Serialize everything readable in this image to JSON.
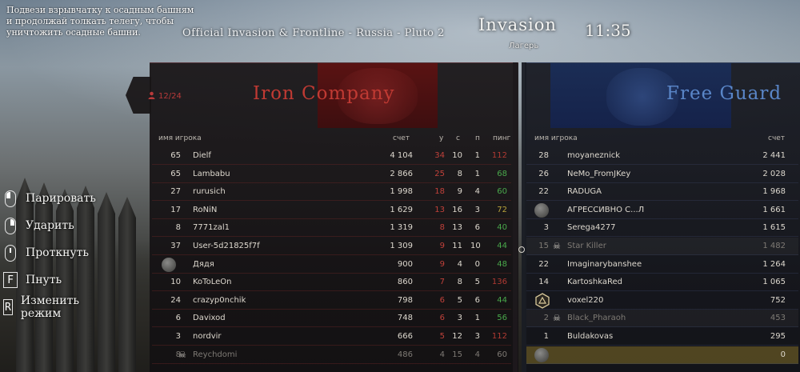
{
  "objective": "Подвези взрывчатку к осадным башням и продолжай толкать телегу, чтобы уничтожить осадные башни.",
  "server_name": "Official Invasion & Frontline - Russia - Pluto 2",
  "mode": {
    "title": "Invasion",
    "subtitle": "Лагерь",
    "clock": "11:35"
  },
  "controls": [
    {
      "icon": "mouse-left-icon",
      "label": "Парировать"
    },
    {
      "icon": "mouse-right-icon",
      "label": "Ударить"
    },
    {
      "icon": "mouse-middle-icon",
      "label": "Проткнуть"
    },
    {
      "key": "F",
      "label": "Пнуть"
    },
    {
      "key": "R",
      "label": "Изменить режим"
    }
  ],
  "left_team": {
    "name": "Iron Company",
    "player_count": "12/24",
    "color": "#c03a33",
    "headers": {
      "name": "имя игрока",
      "score": "счет",
      "kills": "у",
      "deaths": "с",
      "assists": "п",
      "ping": "пинг"
    },
    "players": [
      {
        "level": "65",
        "name": "Dielf",
        "score": "4 104",
        "kills": "34",
        "deaths": "10",
        "assists": "1",
        "ping": "112"
      },
      {
        "level": "65",
        "name": "Lambabu",
        "score": "2 866",
        "kills": "25",
        "deaths": "8",
        "assists": "1",
        "ping": "68"
      },
      {
        "level": "27",
        "name": "rurusich",
        "score": "1 998",
        "kills": "18",
        "deaths": "9",
        "assists": "4",
        "ping": "60"
      },
      {
        "level": "17",
        "name": "RoNiN",
        "score": "1 629",
        "kills": "13",
        "deaths": "16",
        "assists": "3",
        "ping": "72"
      },
      {
        "level": "8",
        "name": "7771zal1",
        "score": "1 319",
        "kills": "8",
        "deaths": "13",
        "assists": "6",
        "ping": "40"
      },
      {
        "level": "37",
        "name": "User-5d21825f7f",
        "score": "1 309",
        "kills": "9",
        "deaths": "11",
        "assists": "10",
        "ping": "44"
      },
      {
        "level": "",
        "name": "Дядя",
        "score": "900",
        "kills": "9",
        "deaths": "4",
        "assists": "0",
        "ping": "48"
      },
      {
        "level": "10",
        "name": "KoToLeOn",
        "score": "860",
        "kills": "7",
        "deaths": "8",
        "assists": "5",
        "ping": "136"
      },
      {
        "level": "24",
        "name": "crazyp0nchik",
        "score": "798",
        "kills": "6",
        "deaths": "5",
        "assists": "6",
        "ping": "44"
      },
      {
        "level": "6",
        "name": "Davixod",
        "score": "748",
        "kills": "6",
        "deaths": "3",
        "assists": "1",
        "ping": "56"
      },
      {
        "level": "3",
        "name": "nordvir",
        "score": "666",
        "kills": "5",
        "deaths": "12",
        "assists": "3",
        "ping": "112"
      },
      {
        "level": "8",
        "name": "Reychdomi",
        "score": "486",
        "kills": "4",
        "deaths": "15",
        "assists": "4",
        "ping": "60"
      }
    ]
  },
  "right_team": {
    "name": "Free Guard",
    "color": "#5a86c8",
    "headers": {
      "name": "имя игрока",
      "score": "счет"
    },
    "players": [
      {
        "level": "28",
        "name": "moyaneznick",
        "score": "2 441"
      },
      {
        "level": "26",
        "name": "NeMo_FromJKey",
        "score": "2 028"
      },
      {
        "level": "22",
        "name": "RADUGA",
        "score": "1 968"
      },
      {
        "level": "",
        "name": "АГРЕССИВНО С...Л",
        "score": "1 661"
      },
      {
        "level": "3",
        "name": "Serega4277",
        "score": "1 615"
      },
      {
        "level": "15",
        "name": "Star Killer",
        "score": "1 482"
      },
      {
        "level": "22",
        "name": "Imaginarybanshee",
        "score": "1 264"
      },
      {
        "level": "14",
        "name": "KartoshkaRed",
        "score": "1 065"
      },
      {
        "level": "",
        "name": "voxel220",
        "score": "752"
      },
      {
        "level": "2",
        "name": "Black_Pharaoh",
        "score": "453"
      },
      {
        "level": "1",
        "name": "Buldakovas",
        "score": "295"
      },
      {
        "level": "",
        "name": "",
        "score": "0"
      }
    ]
  }
}
